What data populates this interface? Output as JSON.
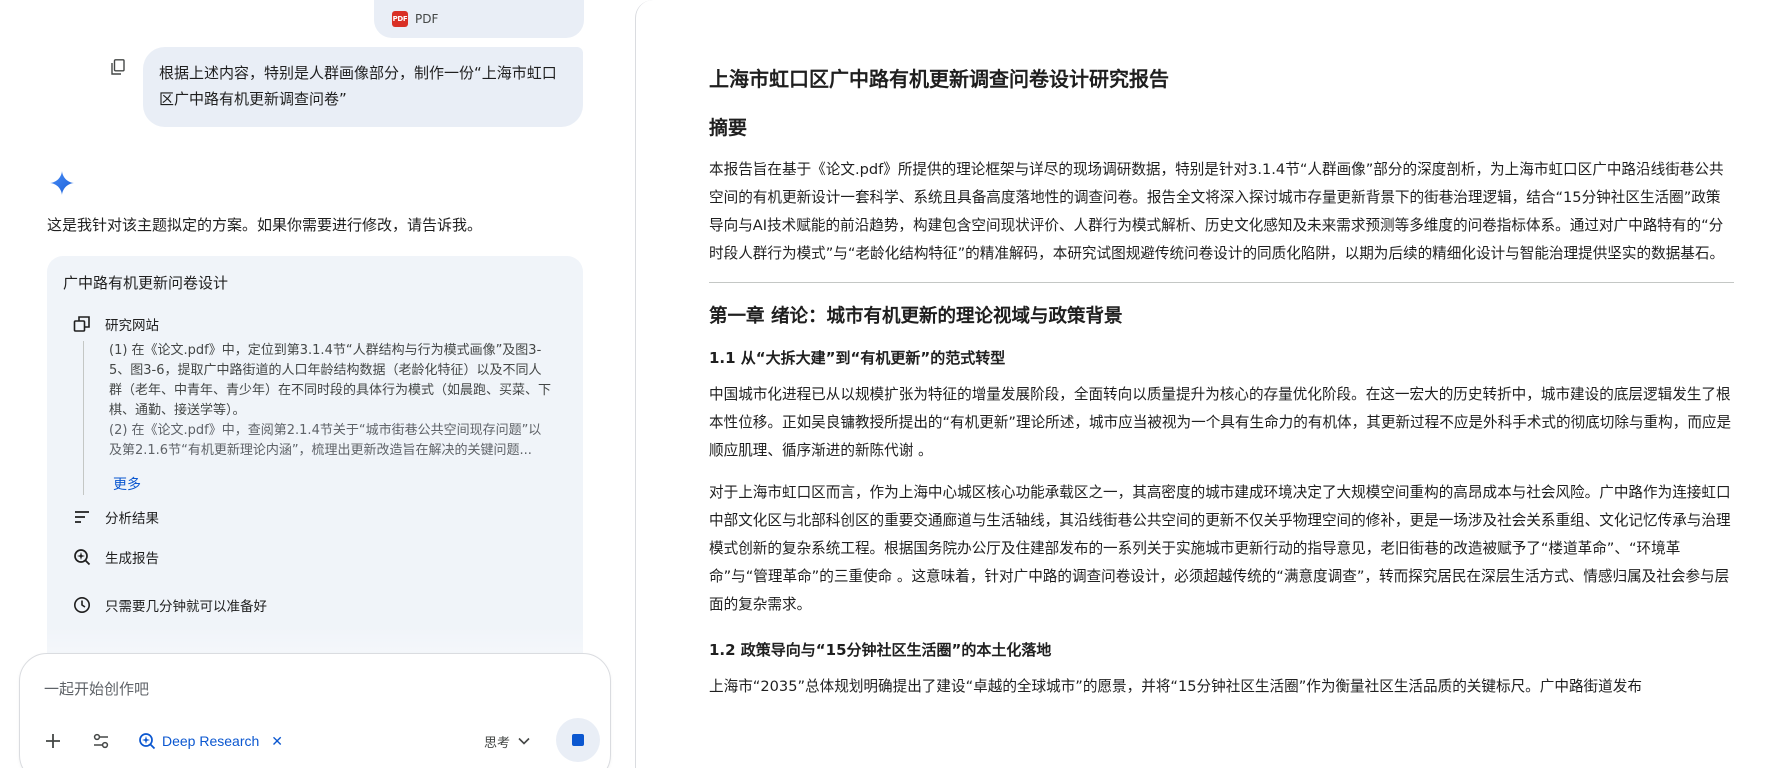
{
  "chat": {
    "attachment_label": "PDF",
    "user_message": "根据上述内容，特别是人群画像部分，制作一份“上海市虹口区广中路有机更新调查问卷”",
    "intro": "这是我针对该主题拟定的方案。如果你需要进行修改，请告诉我。",
    "plan": {
      "title": "广中路有机更新问卷设计",
      "steps": {
        "research": "研究网站",
        "analyze": "分析结果",
        "report": "生成报告",
        "eta": "只需要几分钟就可以准备好"
      },
      "details": [
        "(1) 在《论文.pdf》中，定位到第3.1.4节“人群结构与行为模式画像”及图3-5、图3-6，提取广中路街道的人口年龄结构数据（老龄化特征）以及不同人群（老年、中青年、青少年）在不同时段的具体行为模式（如晨跑、买菜、下棋、通勤、接送学等）。",
        "(2) 在《论文.pdf》中，查阅第2.1.4节关于“城市街巷公共空间现存问题”以及第2.1.6节“有机更新理论内涵”，梳理出更新改造旨在解决的关键问题..."
      ],
      "more": "更多"
    },
    "input": {
      "placeholder": "一起开始创作吧",
      "deep_research": "Deep Research",
      "think": "思考"
    }
  },
  "document": {
    "title": "上海市虹口区广中路有机更新调查问卷设计研究报告",
    "abstract_heading": "摘要",
    "abstract": "本报告旨在基于《论文.pdf》所提供的理论框架与详尽的现场调研数据，特别是针对3.1.4节“人群画像”部分的深度剖析，为上海市虹口区广中路沿线街巷公共空间的有机更新设计一套科学、系统且具备高度落地性的调查问卷。报告全文将深入探讨城市存量更新背景下的街巷治理逻辑，结合“15分钟社区生活圈”政策导向与AI技术赋能的前沿趋势，构建包含空间现状评价、人群行为模式解析、历史文化感知及未来需求预测等多维度的问卷指标体系。通过对广中路特有的“分时段人群行为模式”与“老龄化结构特征”的精准解码，本研究试图规避传统问卷设计的同质化陷阱，以期为后续的精细化设计与智能治理提供坚实的数据基石。",
    "chapter1": "第一章 绪论：城市有机更新的理论视域与政策背景",
    "section1_1": "1.1 从“大拆大建”到“有机更新”的范式转型",
    "para1": "中国城市化进程已从以规模扩张为特征的增量发展阶段，全面转向以质量提升为核心的存量优化阶段。在这一宏大的历史转折中，城市建设的底层逻辑发生了根本性位移。正如吴良镛教授所提出的“有机更新”理论所述，城市应当被视为一个具有生命力的有机体，其更新过程不应是外科手术式的彻底切除与重构，而应是顺应肌理、循序渐进的新陈代谢 。",
    "para2": "对于上海市虹口区而言，作为上海中心城区核心功能承载区之一，其高密度的城市建成环境决定了大规模空间重构的高昂成本与社会风险。广中路作为连接虹口中部文化区与北部科创区的重要交通廊道与生活轴线，其沿线街巷公共空间的更新不仅关乎物理空间的修补，更是一场涉及社会关系重组、文化记忆传承与治理模式创新的复杂系统工程。根据国务院办公厅及住建部发布的一系列关于实施城市更新行动的指导意见，老旧街巷的改造被赋予了“楼道革命”、“环境革命”与“管理革命”的三重使命 。这意味着，针对广中路的调查问卷设计，必须超越传统的“满意度调查”，转而探究居民在深层生活方式、情感归属及社会参与层面的复杂需求。",
    "section1_2": "1.2 政策导向与“15分钟社区生活圈”的本土化落地",
    "para3": "上海市“2035”总体规划明确提出了建设“卓越的全球城市”的愿景，并将“15分钟社区生活圈”作为衡量社区生活品质的关键标尺。广中路街道发布"
  }
}
